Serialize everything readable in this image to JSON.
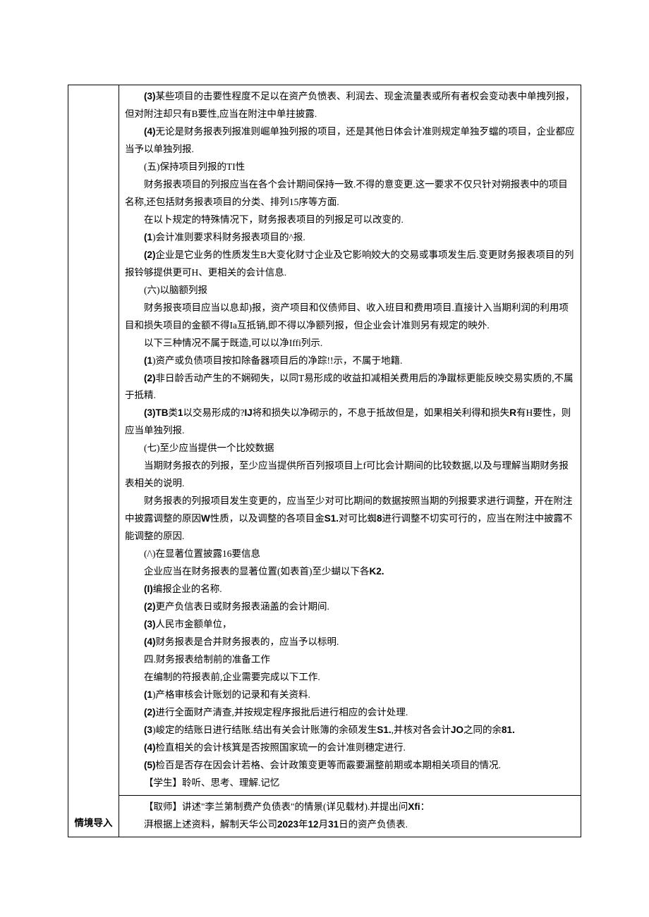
{
  "doc": {
    "leftLabel": "情境导入",
    "mainCell": {
      "lines": [
        {
          "html": "<span class='inline-bold'>(3)</span>某些项目的击要性程度不足以在资产负愤表、利润去、现金流量表或所有者权会变动表中单拽列报，但对附注却只有B要性,应当在附注中单拄披露."
        },
        {
          "html": "<span class='inline-bold'>(4)</span>无论是财务报表列报准则崛单独列报的项目，还是其他日体会计准则规定单独歹蟷的项目，企业都应当予以单独列报."
        },
        {
          "text": "(五)保持项目列报的TI性"
        },
        {
          "text": "财务报表项目的列报应当在各个会计期间保持一致.不得的意变更.这一要求不仅只针对朔报表中的项目名称,还包括财务报表项目的分类、排列15序等方面."
        },
        {
          "text": "在以卜规定的特殊情况下，财务报表项目的列报足可以改变的."
        },
        {
          "html": "<span class='inline-bold'>(1</span>)会计准则要求科财务报表项目的^报."
        },
        {
          "html": "<span class='inline-bold'>(2)</span>企业是它业务的性质发生B大变化财寸企业及它影响姣大的交易或事项发生后.变更财务报表项目的列报铃够提供更可H、更相关的会计信息."
        },
        {
          "text": "(六)以脑额列报"
        },
        {
          "text": "财务报丧项目应当以息却)报，资产项目和仪债师目、收入班目和费用项目.直接计入当期利润的利用项目和损失项目的金额不得Ia互抵销,即不得以净额列报，但企业会计准则另有规定的映外."
        },
        {
          "text": "以下三种情况不属于既造,可以以净Iffi列示."
        },
        {
          "html": "<span class='inline-bold'>(1</span>)资产或负债项目按扣除备器项目后的净踪!!示，不属于地籍."
        },
        {
          "html": "<span class='inline-bold'>(2)</span>非日龄舌动产生的不娴砌失，以同T易形成的收益扣减相关费用后的净蹴标更能反映交易实质的,不属于抵精."
        },
        {
          "html": "<span class='inline-bold'>(3)TB</span>类<span class='inline-bold'>1</span>以交易形成的?<span class='inline-bold'>IJ</span>将和损失以净砌示的，不息于抵故但是，如果相关利得和损失<span class='inline-bold'>R</span>有H要性，则应当单独列报."
        },
        {
          "text": "(七)至少应当提供一个比姣数据"
        },
        {
          "text": "当期财务报衣的列报，至少应当提供所百列报项目上f可比会计期间的比较数据,以及与理解当期财务报表相关的说明."
        },
        {
          "html": "财务报表的列报项目发生变更的，应当至少对可比期间的数据按照当期的列报要求进行调整，开在附注中披露调整的原因<span class='inline-bold'>W</span>性质，以及调整的各项目金<span class='inline-bold'>S1.</span>对可比蜘<span class='inline-bold'>8</span>进行调整不切实可行的，应当在附注中披露不能调整的原因."
        },
        {
          "text": "(/\\)在显著位置披露16要信息"
        },
        {
          "html": "企业应当在财务报表的显著位置(如表首)至少蝴以下各<span class='inline-bold'>K2.</span>"
        },
        {
          "html": "<span class='inline-bold'>(I)</span>编报企业的名称."
        },
        {
          "html": "<span class='inline-bold'>(2)</span>更产负信表日或财务报表涵盖的会计期间."
        },
        {
          "html": "<span class='inline-bold'>(3)</span>人民市金额单位，"
        },
        {
          "html": "<span class='inline-bold'>(4)</span>财务报表是合并财务报表的，应当予以标明."
        },
        {
          "text": "四.财务报表给制前的准备工作"
        },
        {
          "text": "在编制的符报表前,企业需要完成以下工作."
        },
        {
          "html": "<span class='inline-bold'>(1</span>)产格审核会计账划的记录和有关资料."
        },
        {
          "html": "<span class='inline-bold'>(2)</span>进行全面财产清查,并按规定程序报批后进行相应的会计处理."
        },
        {
          "html": "<span class='inline-bold'>(3</span>)峻定的结账日进行结账.结出有关会计账簿的余硕发生<span class='inline-bold'>S1.</span>,并核对各会计<span class='inline-bold'>JO</span>之同的余<span class='inline-bold'>81.</span>"
        },
        {
          "html": "<span class='inline-bold'>(4)</span>检直相关的会计核箕是否按照国家琉一的会计准则穗定进行."
        },
        {
          "html": "<span class='inline-bold'>(5)</span>检百是否存在因会计若格、会计政策变更等而霰要漏整前期或本期相关项目的情况."
        },
        {
          "text": "【学生】聆听、思考、理解.记忆"
        }
      ]
    },
    "secondCell": {
      "lines": [
        {
          "html": "【取师】讲述\"李兰第制费产负债表\"的情景(详见载材).并提出问<span class='inline-bold'>Xfi</span>："
        },
        {
          "html": "湃根据上述资料，解制天华公司<span class='inline-bold'>2023</span>年<span class='inline-bold'>12</span>月<span class='inline-bold'>31</span>日的资产负债表."
        }
      ]
    }
  }
}
